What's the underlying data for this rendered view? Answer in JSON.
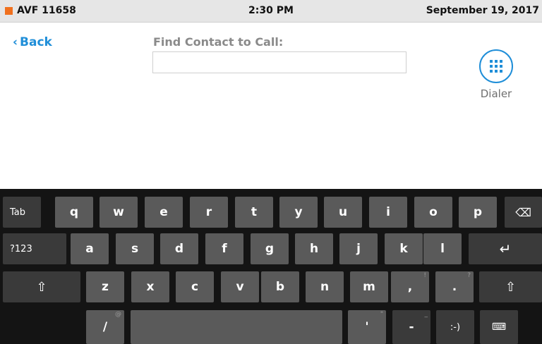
{
  "status_bar": {
    "indicator_color": "#f0701e",
    "room_name": "AVF 11658",
    "time": "2:30 PM",
    "date": "September 19, 2017"
  },
  "nav": {
    "back_label": "Back",
    "back_icon": "chevron-left-icon"
  },
  "search": {
    "label": "Find Contact to Call:",
    "value": ""
  },
  "dialer": {
    "label": "Dialer",
    "icon": "keypad-grid-icon"
  },
  "keyboard": {
    "row1": [
      "Tab",
      "q",
      "w",
      "e",
      "r",
      "t",
      "y",
      "u",
      "i",
      "o",
      "p",
      "⌫"
    ],
    "row2": [
      "?123",
      "a",
      "s",
      "d",
      "f",
      "g",
      "h",
      "j",
      "k",
      "l",
      "↵"
    ],
    "row3": [
      "⇧",
      "z",
      "x",
      "c",
      "v",
      "b",
      "n",
      "m",
      ",",
      ".",
      "⇧"
    ],
    "row3_sups": {
      "comma": "!",
      "period": "?"
    },
    "row4": {
      "slash": "/",
      "slash_sup": "@",
      "space": "",
      "apostrophe": "'",
      "apostrophe_sup": "\"",
      "dash": "-",
      "dash_sup": "_",
      "smiley": ":-)",
      "hide_keyboard": "⌨"
    }
  }
}
